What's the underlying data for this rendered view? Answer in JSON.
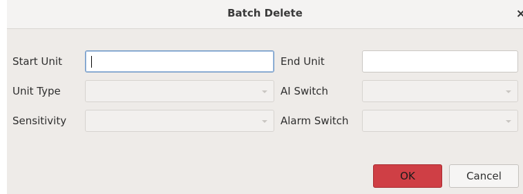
{
  "dialog": {
    "title": "Batch Delete",
    "close_glyph": "×"
  },
  "form": {
    "start_unit": {
      "label": "Start Unit",
      "value": ""
    },
    "end_unit": {
      "label": "End Unit",
      "value": ""
    },
    "unit_type": {
      "label": "Unit Type",
      "selected": ""
    },
    "ai_switch": {
      "label": "AI Switch",
      "selected": ""
    },
    "sensitivity": {
      "label": "Sensitivity",
      "selected": ""
    },
    "alarm_switch": {
      "label": "Alarm Switch",
      "selected": ""
    }
  },
  "buttons": {
    "ok": "OK",
    "cancel": "Cancel"
  }
}
